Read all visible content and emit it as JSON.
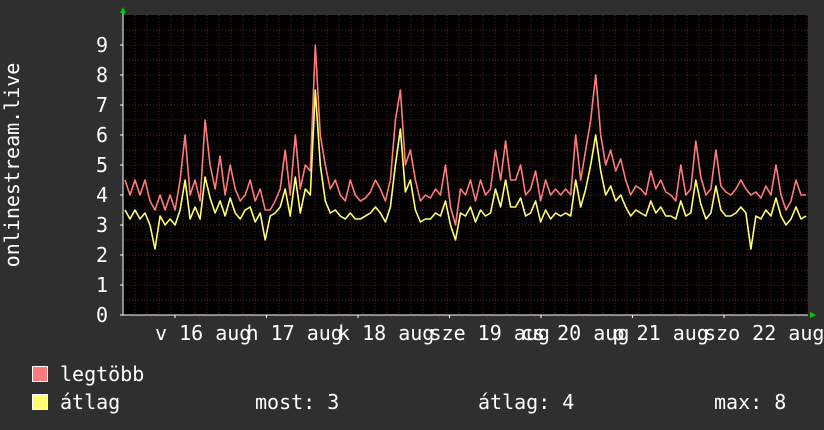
{
  "chart_data": {
    "type": "line",
    "ylabel": "onlinestream.live",
    "ylim": [
      0,
      10
    ],
    "yticks": [
      0,
      1,
      2,
      3,
      4,
      5,
      6,
      7,
      8,
      9
    ],
    "xticks": [
      "v 16 aug",
      "h 17 aug",
      "k 18 aug",
      "sze 19 aug",
      "cs 20 aug",
      "p 21 aug",
      "szo 22 aug"
    ],
    "grid": true,
    "legend_position": "bottom-left",
    "series": [
      {
        "name": "legtöbb",
        "color": "#ff7b7b",
        "values": [
          4.5,
          4.0,
          4.5,
          4.0,
          4.5,
          3.8,
          3.5,
          4.0,
          3.5,
          4.0,
          3.5,
          4.5,
          6.0,
          4.0,
          4.5,
          3.8,
          6.5,
          5.0,
          4.2,
          5.3,
          4.0,
          5.0,
          4.2,
          3.8,
          4.0,
          4.5,
          3.8,
          4.2,
          3.5,
          3.5,
          3.8,
          4.2,
          5.5,
          4.0,
          6.0,
          4.2,
          5.0,
          4.8,
          9.0,
          6.0,
          5.0,
          4.2,
          4.5,
          4.0,
          3.8,
          4.5,
          4.0,
          3.8,
          3.9,
          4.1,
          4.5,
          4.2,
          3.8,
          4.5,
          6.5,
          7.5,
          5.0,
          5.5,
          4.5,
          3.8,
          4.0,
          3.9,
          4.2,
          4.0,
          5.0,
          3.6,
          3.0,
          4.2,
          4.0,
          4.5,
          3.8,
          4.5,
          4.0,
          4.2,
          5.5,
          4.5,
          5.8,
          4.5,
          4.5,
          5.0,
          4.0,
          4.2,
          4.8,
          3.8,
          4.5,
          4.0,
          4.2,
          4.0,
          4.2,
          4.0,
          6.0,
          4.5,
          5.5,
          6.5,
          8.0,
          6.0,
          5.0,
          5.5,
          4.8,
          5.2,
          4.5,
          4.0,
          4.3,
          4.2,
          4.0,
          4.8,
          4.2,
          4.5,
          4.1,
          4.0,
          3.8,
          5.0,
          4.0,
          4.2,
          5.8,
          4.6,
          4.0,
          4.2,
          5.5,
          4.3,
          4.1,
          4.0,
          4.2,
          4.5,
          4.2,
          4.0,
          4.1,
          3.9,
          4.3,
          4.0,
          5.0,
          4.0,
          3.5,
          3.8,
          4.5,
          4.0,
          4.0
        ]
      },
      {
        "name": "átlag",
        "color": "#ffff70",
        "values": [
          3.5,
          3.2,
          3.5,
          3.2,
          3.4,
          3.0,
          2.2,
          3.3,
          3.0,
          3.2,
          3.0,
          3.5,
          4.5,
          3.2,
          3.6,
          3.2,
          4.6,
          3.9,
          3.4,
          3.8,
          3.3,
          3.9,
          3.4,
          3.2,
          3.5,
          3.6,
          3.1,
          3.4,
          2.5,
          3.3,
          3.4,
          3.6,
          4.2,
          3.3,
          4.6,
          3.4,
          4.2,
          4.0,
          7.5,
          5.0,
          3.8,
          3.4,
          3.5,
          3.3,
          3.2,
          3.4,
          3.2,
          3.2,
          3.3,
          3.4,
          3.6,
          3.4,
          3.1,
          3.6,
          5.0,
          6.2,
          4.1,
          4.5,
          3.5,
          3.1,
          3.2,
          3.2,
          3.4,
          3.3,
          3.8,
          3.0,
          2.5,
          3.4,
          3.3,
          3.6,
          3.1,
          3.5,
          3.3,
          3.4,
          4.2,
          3.6,
          4.5,
          3.6,
          3.6,
          3.9,
          3.3,
          3.4,
          3.8,
          3.1,
          3.5,
          3.2,
          3.4,
          3.3,
          3.4,
          3.3,
          4.5,
          3.6,
          4.2,
          5.0,
          6.0,
          4.8,
          4.0,
          4.3,
          3.8,
          4.0,
          3.6,
          3.3,
          3.5,
          3.4,
          3.3,
          3.8,
          3.4,
          3.6,
          3.3,
          3.3,
          3.2,
          3.8,
          3.3,
          3.4,
          4.5,
          3.7,
          3.2,
          3.4,
          4.3,
          3.5,
          3.3,
          3.3,
          3.4,
          3.6,
          3.4,
          2.2,
          3.3,
          3.2,
          3.5,
          3.3,
          3.9,
          3.3,
          3.0,
          3.2,
          3.6,
          3.2,
          3.3
        ]
      }
    ]
  },
  "legend": {
    "items": [
      {
        "label": "legtöbb",
        "color": "#ff7b7b"
      },
      {
        "label": "átlag",
        "color": "#ffff70"
      }
    ]
  },
  "stats": {
    "most": "most: 3",
    "atlag": "átlag: 4",
    "max": "max: 8"
  },
  "colors": {
    "background": "#2f2f2f",
    "plot_background": "#000000",
    "grid": "#5a2424",
    "axis": "#ffffff",
    "arrow": "#00cc00"
  }
}
